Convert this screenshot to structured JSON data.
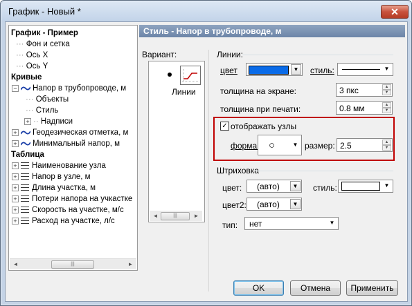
{
  "window": {
    "title": "График - Новый *",
    "close_glyph": "✕"
  },
  "tree": {
    "items": [
      {
        "label": "График - Пример"
      },
      {
        "label": "Фон и сетка"
      },
      {
        "label": "Ось X"
      },
      {
        "label": "Ось Y"
      },
      {
        "label": "Кривые"
      },
      {
        "label": "Напор в трубопроводе, м"
      },
      {
        "label": "Объекты"
      },
      {
        "label": "Стиль"
      },
      {
        "label": "Надписи"
      },
      {
        "label": "Геодезическая отметка, м"
      },
      {
        "label": "Минимальный напор, м"
      },
      {
        "label": "Таблица"
      },
      {
        "label": "Наименование узла"
      },
      {
        "label": "Напор в узле, м"
      },
      {
        "label": "Длина участка, м"
      },
      {
        "label": "Потери напора на учкастке"
      },
      {
        "label": "Скорость на участке, м/с"
      },
      {
        "label": "Расход на участке, л/с"
      }
    ],
    "scroll_left": "◄",
    "scroll_right": "►",
    "scroll_thumb": "|||"
  },
  "panel": {
    "header": "Стиль - Напор в трубопроводе, м"
  },
  "variant": {
    "label": "Вариант:",
    "item": "Линии",
    "scroll_left": "◄",
    "scroll_right": "►",
    "scroll_thumb": "|||"
  },
  "lines": {
    "group": "Линии:",
    "color_label": "цвет",
    "color_value": "#0a6be8",
    "style_label": "стиль:",
    "screen_width_label": "толщина на экране:",
    "screen_width": "3 пкс",
    "print_width_label": "толщина при печати:",
    "print_width": "0.8 мм",
    "show_nodes": "отображать узлы",
    "shape_label": "форма:",
    "shape_value": "○",
    "size_label": "размер:",
    "size_value": "2.5"
  },
  "hatch": {
    "group": "Штриховка",
    "color_label": "цвет:",
    "color_value": "(авто)",
    "style_label": "стиль:",
    "color2_label": "цвет2:",
    "color2_value": "(авто)",
    "type_label": "тип:",
    "type_value": "нет"
  },
  "buttons": {
    "ok": "OK",
    "cancel": "Отмена",
    "apply": "Применить"
  },
  "highlight_color": "#c00000"
}
